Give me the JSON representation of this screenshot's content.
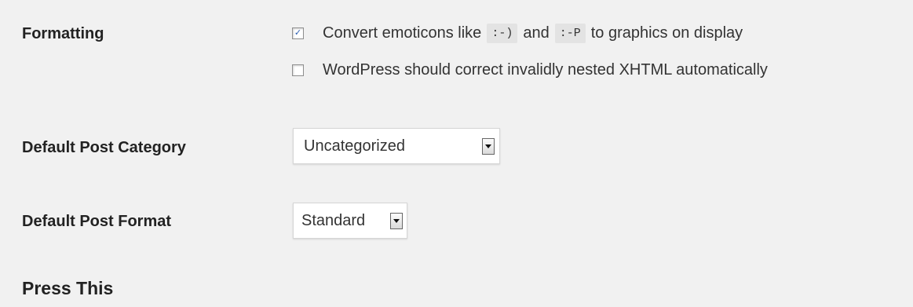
{
  "formatting": {
    "label": "Formatting",
    "option1": {
      "checked": true,
      "text_before": "Convert emoticons like",
      "code1": ":-)",
      "text_middle": "and",
      "code2": ":-P",
      "text_after": "to graphics on display"
    },
    "option2": {
      "checked": false,
      "text": "WordPress should correct invalidly nested XHTML automatically"
    }
  },
  "default_post_category": {
    "label": "Default Post Category",
    "selected": "Uncategorized"
  },
  "default_post_format": {
    "label": "Default Post Format",
    "selected": "Standard"
  },
  "press_this": {
    "title": "Press This"
  },
  "icons": {
    "checkmark": "☑",
    "dropdown": "chevron-down-icon"
  }
}
